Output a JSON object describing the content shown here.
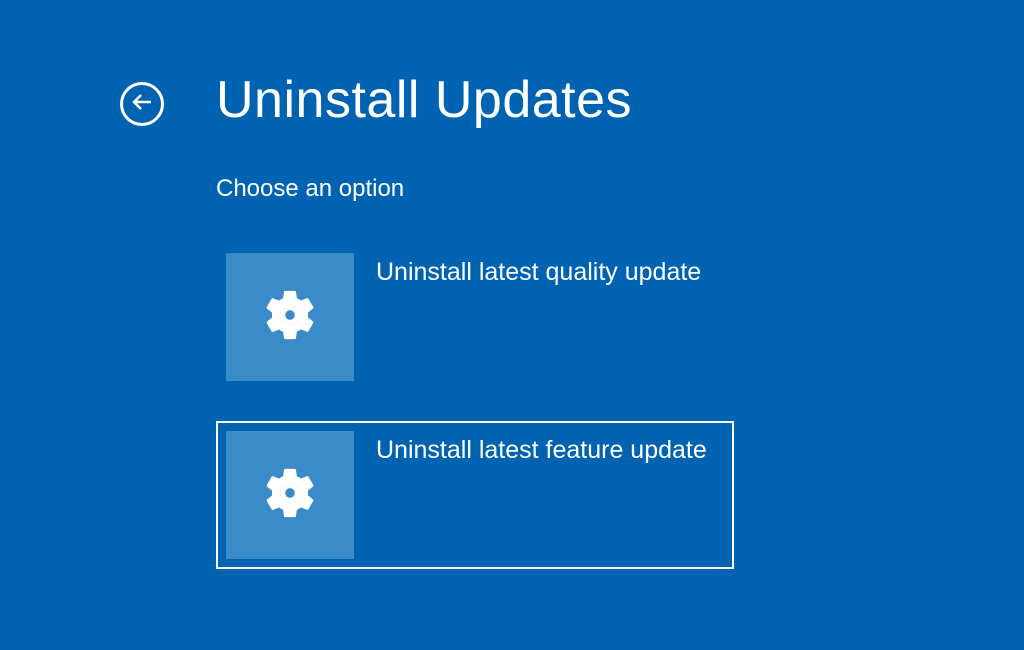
{
  "page_title": "Uninstall Updates",
  "subtitle": "Choose an option",
  "options": [
    {
      "label": "Uninstall latest quality update",
      "selected": false
    },
    {
      "label": "Uninstall latest feature update",
      "selected": true
    }
  ]
}
